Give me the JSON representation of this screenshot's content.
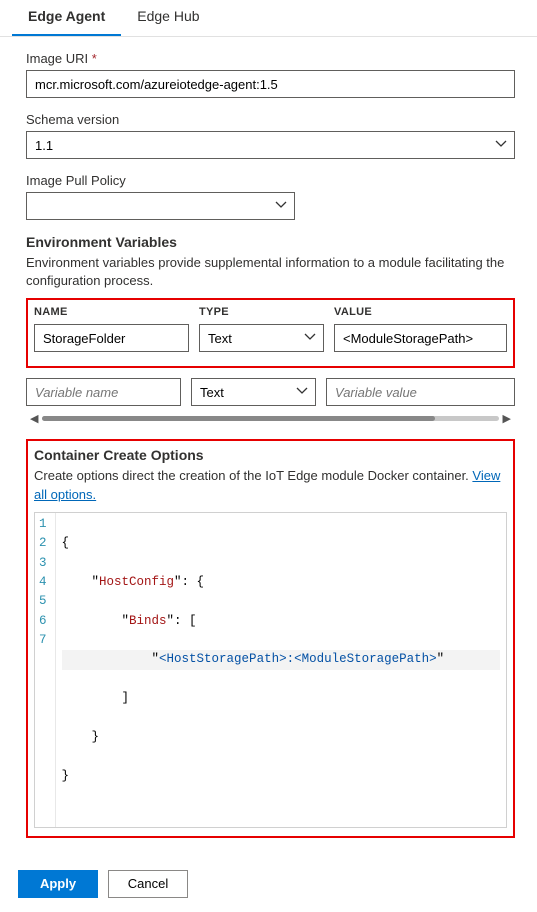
{
  "tabs": {
    "edgeAgent": "Edge Agent",
    "edgeHub": "Edge Hub"
  },
  "fields": {
    "imageUri": {
      "label": "Image URI",
      "value": "mcr.microsoft.com/azureiotedge-agent:1.5"
    },
    "schemaVersion": {
      "label": "Schema version",
      "value": "1.1"
    },
    "imagePullPolicy": {
      "label": "Image Pull Policy",
      "value": ""
    }
  },
  "env": {
    "heading": "Environment Variables",
    "desc": "Environment variables provide supplemental information to a module facilitating the configuration process.",
    "headers": {
      "name": "NAME",
      "type": "TYPE",
      "value": "VALUE"
    },
    "rows": [
      {
        "name": "StorageFolder",
        "type": "Text",
        "value": "<ModuleStoragePath>"
      }
    ],
    "blank": {
      "namePh": "Variable name",
      "type": "Text",
      "valuePh": "Variable value"
    }
  },
  "createOpts": {
    "heading": "Container Create Options",
    "desc": "Create options direct the creation of the IoT Edge module Docker container. ",
    "link": "View all options.",
    "code": {
      "l1": "{",
      "l2a": "    \"",
      "l2k": "HostConfig",
      "l2b": "\": {",
      "l3a": "        \"",
      "l3k": "Binds",
      "l3b": "\": [",
      "l4a": "            \"",
      "l4v": "<HostStoragePath>:<ModuleStoragePath>",
      "l4b": "\"",
      "l5": "        ]",
      "l6": "    }",
      "l7": "}"
    }
  },
  "buttons": {
    "apply": "Apply",
    "cancel": "Cancel"
  },
  "gutter": [
    "1",
    "2",
    "3",
    "4",
    "5",
    "6",
    "7"
  ]
}
